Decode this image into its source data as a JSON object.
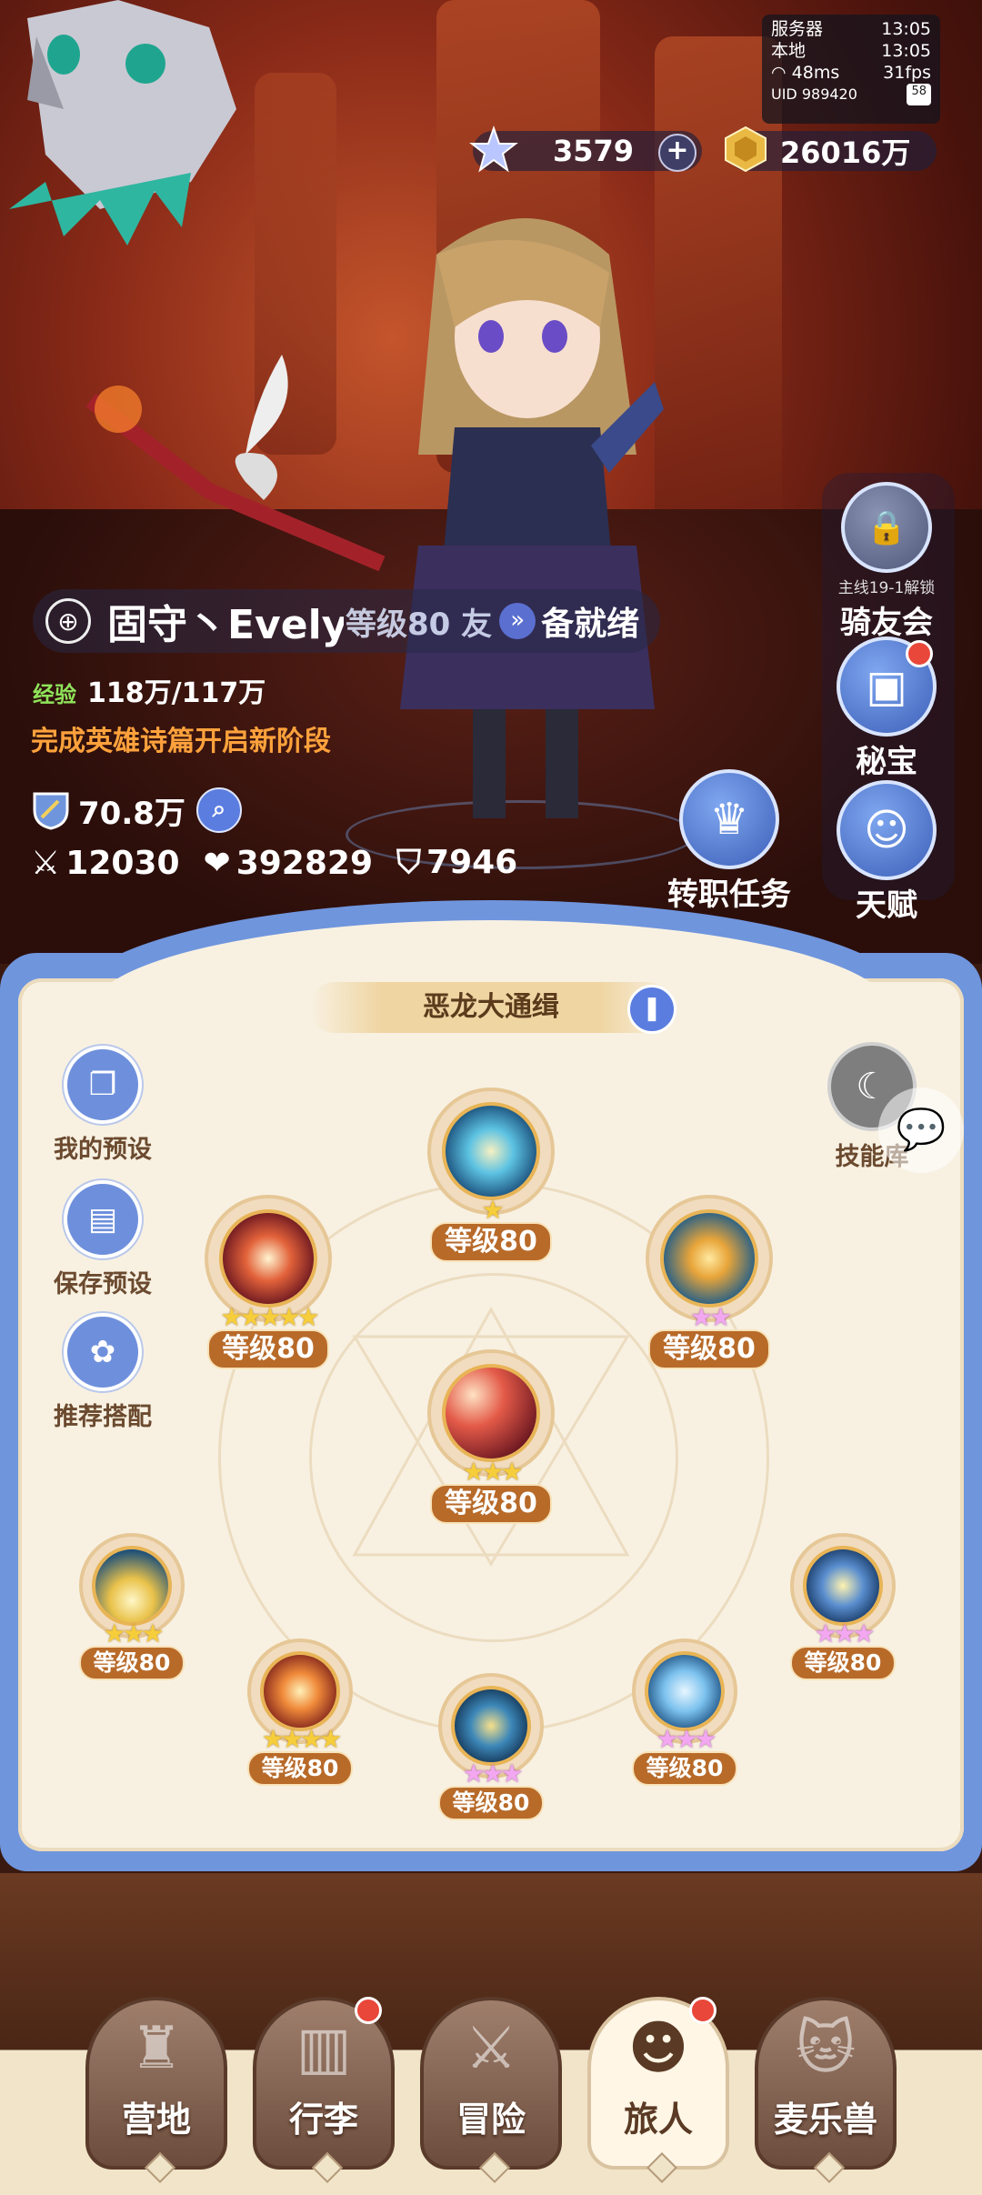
{
  "status": {
    "server_label": "服务器",
    "server_time": "13:05",
    "local_label": "本地",
    "local_time": "13:05",
    "ping": "48ms",
    "fps": "31fps",
    "uid": "UID 989420",
    "battery": "58"
  },
  "currency": {
    "stars": "3579",
    "gold": "26016万"
  },
  "player": {
    "name": "固守丶Evely",
    "team_status": "等级80 友",
    "ready": "备就绪",
    "exp_label": "经验",
    "exp_value": "118万/117万",
    "quest_hint": "完成英雄诗篇开启新阶段",
    "power": "70.8万",
    "attack": "12030",
    "hp": "392829",
    "defense": "7946"
  },
  "side_buttons": {
    "mount_lock": "主线19-1解锁",
    "mount": "骑友会",
    "treasure": "秘宝",
    "job_task": "转职任务",
    "talent": "天赋"
  },
  "skill_panel": {
    "title": "恶龙大通缉",
    "my_preset": "我的预设",
    "save_preset": "保存预设",
    "recommend": "推荐搭配",
    "skill_library": "技能库",
    "skills": [
      {
        "level": "等级80",
        "stars": "★",
        "star_color": "gold"
      },
      {
        "level": "等级80",
        "stars": "★★★★★",
        "star_color": "gold"
      },
      {
        "level": "等级80",
        "stars": "★★",
        "star_color": "pink"
      },
      {
        "level": "等级80",
        "stars": "★★★",
        "star_color": "gold"
      },
      {
        "level": "等级80",
        "stars": "★★★",
        "star_color": "gold"
      },
      {
        "level": "等级80",
        "stars": "★★★",
        "star_color": "pink"
      },
      {
        "level": "等级80",
        "stars": "★★★★",
        "star_color": "gold"
      },
      {
        "level": "等级80",
        "stars": "★★★",
        "star_color": "pink"
      },
      {
        "level": "等级80",
        "stars": "★★★",
        "star_color": "pink"
      }
    ]
  },
  "nav": {
    "camp": "营地",
    "bag": "行李",
    "adventure": "冒险",
    "traveler": "旅人",
    "pet": "麦乐兽"
  }
}
